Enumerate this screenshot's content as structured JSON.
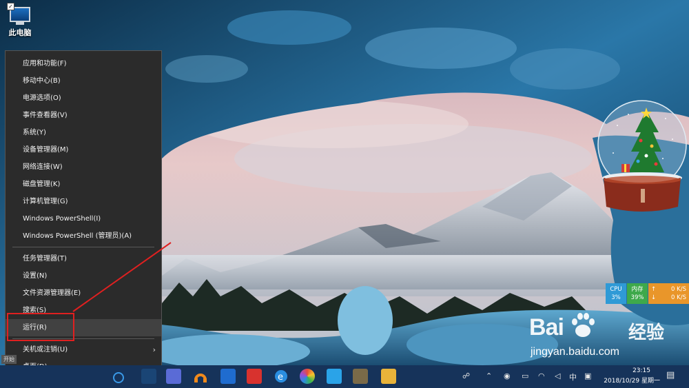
{
  "desktop": {
    "icon_label": "此电脑"
  },
  "winx_menu": {
    "group1": [
      "应用和功能(F)",
      "移动中心(B)",
      "电源选项(O)",
      "事件查看器(V)",
      "系统(Y)",
      "设备管理器(M)",
      "网络连接(W)",
      "磁盘管理(K)",
      "计算机管理(G)",
      "Windows PowerShell(I)",
      "Windows PowerShell (管理员)(A)"
    ],
    "group2": [
      "任务管理器(T)",
      "设置(N)",
      "文件资源管理器(E)",
      "搜索(S)",
      "运行(R)"
    ],
    "group3": [
      "关机或注销(U)",
      "桌面(D)"
    ],
    "highlighted_item": "运行(R)"
  },
  "monitor": {
    "cpu_label": "CPU",
    "cpu_value": "3%",
    "mem_label": "内存",
    "mem_value": "39%",
    "up_value": "0 K/S",
    "down_value": "0 K/S"
  },
  "watermark": {
    "brand": "Bai",
    "brand_suffix": "经验",
    "url": "jingyan.baidu.com"
  },
  "taskbar": {
    "start_tip": "开始",
    "ime": "中",
    "time": "23:15",
    "date": "2018/10/29 星期一"
  },
  "colors": {
    "accent_red": "#e02020",
    "taskbar": "#16335a",
    "menu_bg": "#2b2b2b",
    "cpu": "#2f9ad6",
    "mem": "#3ea94b",
    "net": "#e9962a"
  }
}
